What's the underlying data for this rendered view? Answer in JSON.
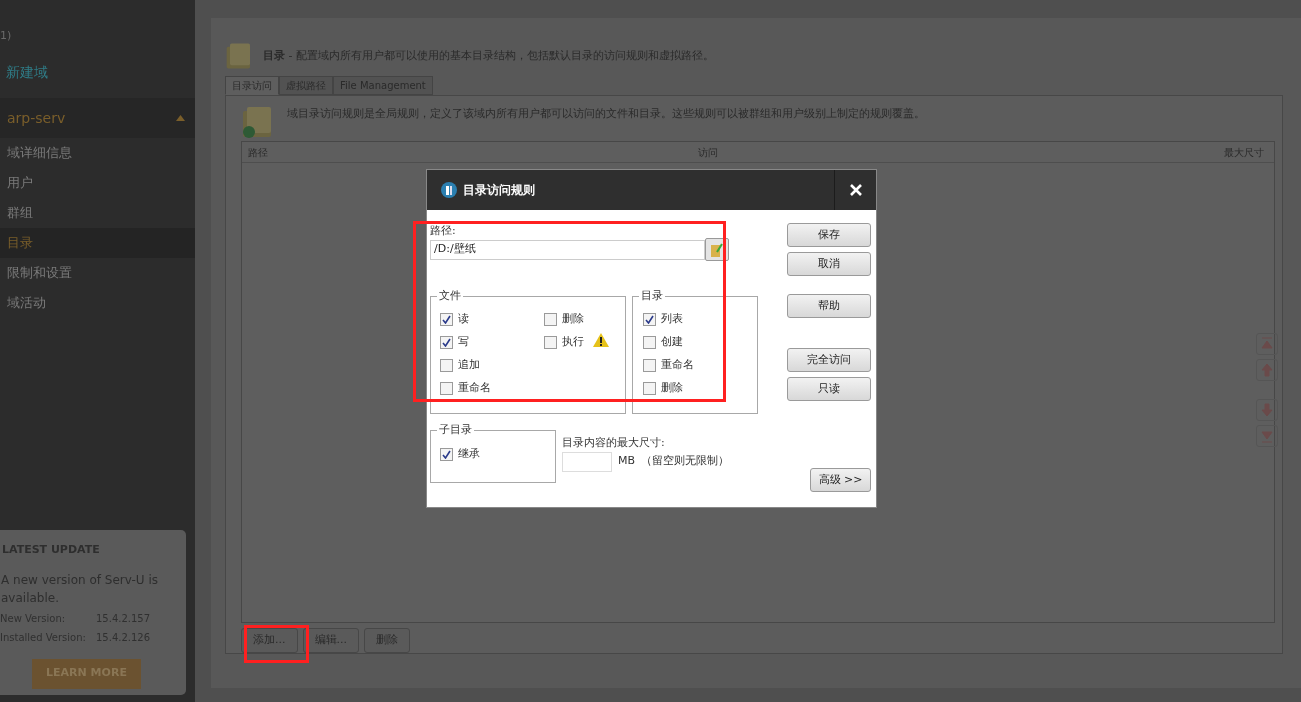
{
  "sidebar": {
    "partial_count": "1)",
    "new_domain": "新建域",
    "domain": {
      "name": "arp-serv",
      "expanded": true
    },
    "items": [
      {
        "label": "域详细信息",
        "selected": false
      },
      {
        "label": "用户",
        "selected": false
      },
      {
        "label": "群组",
        "selected": false
      },
      {
        "label": "目录",
        "selected": true
      },
      {
        "label": "限制和设置",
        "selected": false
      },
      {
        "label": "域活动",
        "selected": false
      }
    ]
  },
  "update_card": {
    "title": "LATEST UPDATE",
    "message": "A new version of Serv-U is available.",
    "rows": [
      {
        "label": "New Version:",
        "value": "15.4.2.157"
      },
      {
        "label": "Installed Version:",
        "value": "15.4.2.126"
      }
    ],
    "button": "LEARN MORE"
  },
  "page": {
    "title": "目录",
    "description": " - 配置域内所有用户都可以使用的基本目录结构，包括默认目录的访问规则和虚拟路径。",
    "tabs": [
      {
        "label": "目录访问",
        "selected": true
      },
      {
        "label": "虚拟路径",
        "selected": false
      },
      {
        "label": "File Management",
        "selected": false
      }
    ],
    "rule_text": "域目录访问规则是全局规则，定义了该域内所有用户都可以访问的文件和目录。这些规则可以被群组和用户级别上制定的规则覆盖。",
    "table": {
      "columns": [
        "路径",
        "访问",
        "最大尺寸"
      ]
    },
    "buttons": [
      "添加...",
      "编辑...",
      "删除"
    ]
  },
  "dialog": {
    "title": "目录访问规则",
    "path_label": "路径:",
    "path_value": "/D:/壁纸",
    "file_group": {
      "title": "文件",
      "columns": [
        [
          {
            "label": "读",
            "checked": true,
            "warning": false
          },
          {
            "label": "写",
            "checked": true,
            "warning": false
          },
          {
            "label": "追加",
            "checked": false,
            "warning": false
          },
          {
            "label": "重命名",
            "checked": false,
            "warning": false
          }
        ],
        [
          {
            "label": "删除",
            "checked": false,
            "warning": false
          },
          {
            "label": "执行",
            "checked": false,
            "warning": true
          }
        ]
      ]
    },
    "dir_group": {
      "title": "目录",
      "options": [
        {
          "label": "列表",
          "checked": true
        },
        {
          "label": "创建",
          "checked": false
        },
        {
          "label": "重命名",
          "checked": false
        },
        {
          "label": "删除",
          "checked": false
        }
      ]
    },
    "subdir_group": {
      "title": "子目录",
      "options": [
        {
          "label": "继承",
          "checked": true
        }
      ]
    },
    "max_size_label": "目录内容的最大尺寸:",
    "unit": "MB",
    "hint": "（留空则无限制）",
    "buttons": [
      [
        "保存",
        "取消"
      ],
      [
        "帮助"
      ],
      [
        "完全访问",
        "只读"
      ]
    ],
    "advanced_button": "高级 >>"
  }
}
